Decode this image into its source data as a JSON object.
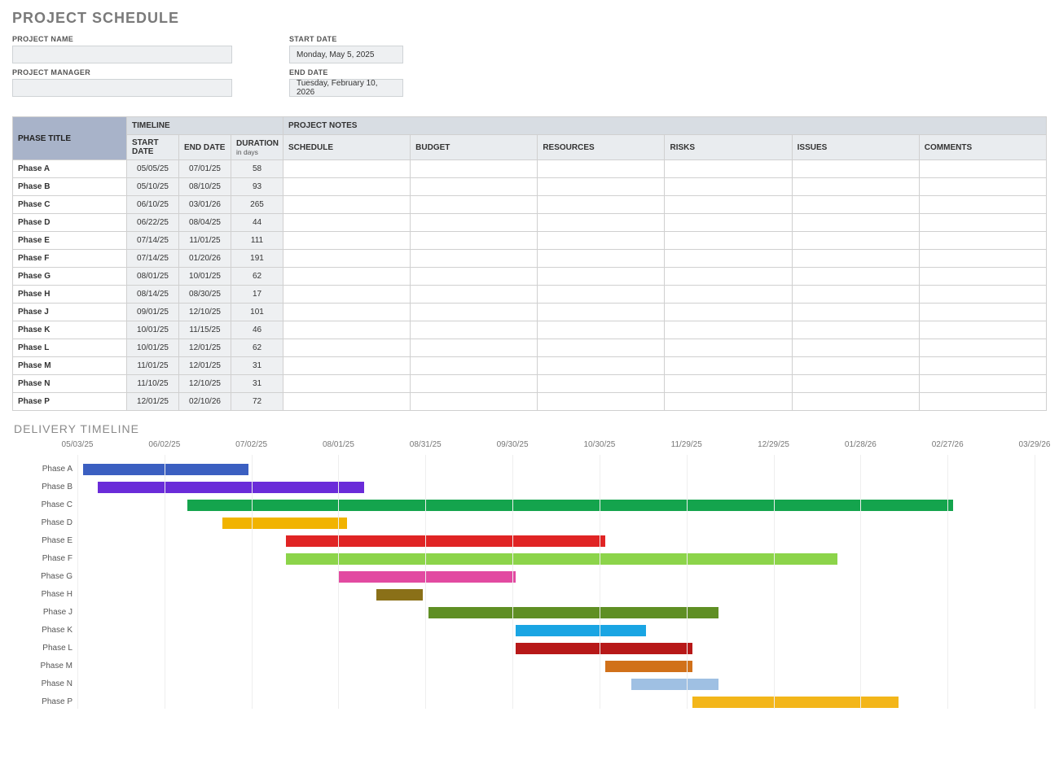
{
  "title": "PROJECT SCHEDULE",
  "fields": {
    "project_name_label": "PROJECT NAME",
    "project_name_value": "",
    "project_manager_label": "PROJECT MANAGER",
    "project_manager_value": "",
    "start_date_label": "START DATE",
    "start_date_value": "Monday, May 5, 2025",
    "end_date_label": "END DATE",
    "end_date_value": "Tuesday, February 10, 2026"
  },
  "table": {
    "group_timeline": "TIMELINE",
    "group_notes": "PROJECT NOTES",
    "col_phase": "PHASE TITLE",
    "col_start": "START DATE",
    "col_end": "END DATE",
    "col_duration": "DURATION",
    "col_duration_sub": "in days",
    "col_schedule": "SCHEDULE",
    "col_budget": "BUDGET",
    "col_resources": "RESOURCES",
    "col_risks": "RISKS",
    "col_issues": "ISSUES",
    "col_comments": "COMMENTS",
    "rows": [
      {
        "phase": "Phase A",
        "start": "05/05/25",
        "end": "07/01/25",
        "dur": "58"
      },
      {
        "phase": "Phase B",
        "start": "05/10/25",
        "end": "08/10/25",
        "dur": "93"
      },
      {
        "phase": "Phase C",
        "start": "06/10/25",
        "end": "03/01/26",
        "dur": "265"
      },
      {
        "phase": "Phase D",
        "start": "06/22/25",
        "end": "08/04/25",
        "dur": "44"
      },
      {
        "phase": "Phase E",
        "start": "07/14/25",
        "end": "11/01/25",
        "dur": "111"
      },
      {
        "phase": "Phase F",
        "start": "07/14/25",
        "end": "01/20/26",
        "dur": "191"
      },
      {
        "phase": "Phase G",
        "start": "08/01/25",
        "end": "10/01/25",
        "dur": "62"
      },
      {
        "phase": "Phase H",
        "start": "08/14/25",
        "end": "08/30/25",
        "dur": "17"
      },
      {
        "phase": "Phase J",
        "start": "09/01/25",
        "end": "12/10/25",
        "dur": "101"
      },
      {
        "phase": "Phase K",
        "start": "10/01/25",
        "end": "11/15/25",
        "dur": "46"
      },
      {
        "phase": "Phase L",
        "start": "10/01/25",
        "end": "12/01/25",
        "dur": "62"
      },
      {
        "phase": "Phase M",
        "start": "11/01/25",
        "end": "12/01/25",
        "dur": "31"
      },
      {
        "phase": "Phase N",
        "start": "11/10/25",
        "end": "12/10/25",
        "dur": "31"
      },
      {
        "phase": "Phase P",
        "start": "12/01/25",
        "end": "02/10/26",
        "dur": "72"
      }
    ]
  },
  "subtitle": "DELIVERY TIMELINE",
  "chart_data": {
    "type": "bar",
    "title": "DELIVERY TIMELINE",
    "xlabel": "",
    "ylabel": "",
    "x_ticks": [
      "05/03/25",
      "06/02/25",
      "07/02/25",
      "08/01/25",
      "08/31/25",
      "09/30/25",
      "10/30/25",
      "11/29/25",
      "12/29/25",
      "01/28/26",
      "02/27/26",
      "03/29/26"
    ],
    "axis_range": {
      "start": "05/03/25",
      "end": "03/29/26"
    },
    "categories": [
      "Phase A",
      "Phase B",
      "Phase C",
      "Phase D",
      "Phase E",
      "Phase F",
      "Phase G",
      "Phase H",
      "Phase J",
      "Phase K",
      "Phase L",
      "Phase M",
      "Phase N",
      "Phase P"
    ],
    "series": [
      {
        "name": "Phase A",
        "start": "2025-05-05",
        "end": "2025-07-01",
        "duration": 58,
        "color": "#3b5fc1"
      },
      {
        "name": "Phase B",
        "start": "2025-05-10",
        "end": "2025-08-10",
        "duration": 93,
        "color": "#6a2bd9"
      },
      {
        "name": "Phase C",
        "start": "2025-06-10",
        "end": "2026-03-01",
        "duration": 265,
        "color": "#14a44d"
      },
      {
        "name": "Phase D",
        "start": "2025-06-22",
        "end": "2025-08-04",
        "duration": 44,
        "color": "#f1b300"
      },
      {
        "name": "Phase E",
        "start": "2025-07-14",
        "end": "2025-11-01",
        "duration": 111,
        "color": "#e02424"
      },
      {
        "name": "Phase F",
        "start": "2025-07-14",
        "end": "2026-01-20",
        "duration": 191,
        "color": "#8cd44a"
      },
      {
        "name": "Phase G",
        "start": "2025-08-01",
        "end": "2025-10-01",
        "duration": 62,
        "color": "#e24aa1"
      },
      {
        "name": "Phase H",
        "start": "2025-08-14",
        "end": "2025-08-30",
        "duration": 17,
        "color": "#8a7018"
      },
      {
        "name": "Phase J",
        "start": "2025-09-01",
        "end": "2025-12-10",
        "duration": 101,
        "color": "#5f8f24"
      },
      {
        "name": "Phase K",
        "start": "2025-10-01",
        "end": "2025-11-15",
        "duration": 46,
        "color": "#1aa5e3"
      },
      {
        "name": "Phase L",
        "start": "2025-10-01",
        "end": "2025-12-01",
        "duration": 62,
        "color": "#b71818"
      },
      {
        "name": "Phase M",
        "start": "2025-11-01",
        "end": "2025-12-01",
        "duration": 31,
        "color": "#d1711a"
      },
      {
        "name": "Phase N",
        "start": "2025-11-10",
        "end": "2025-12-10",
        "duration": 31,
        "color": "#9fc0e3"
      },
      {
        "name": "Phase P",
        "start": "2025-12-01",
        "end": "2026-02-10",
        "duration": 72,
        "color": "#f3b61a"
      }
    ]
  }
}
